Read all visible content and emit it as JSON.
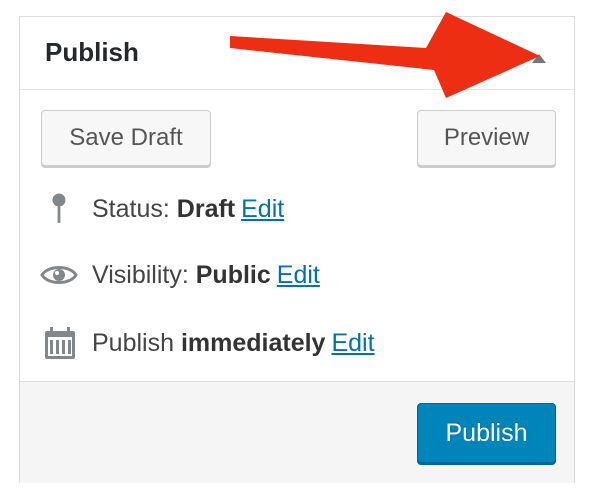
{
  "box": {
    "title": "Publish",
    "toggle_icon": "triangle-up-icon"
  },
  "actions": {
    "save_draft_label": "Save Draft",
    "preview_label": "Preview",
    "publish_label": "Publish"
  },
  "status": {
    "icon": "pin-icon",
    "label": "Status:",
    "value": "Draft",
    "edit_label": "Edit"
  },
  "visibility": {
    "icon": "eye-icon",
    "label": "Visibility:",
    "value": "Public",
    "edit_label": "Edit"
  },
  "schedule": {
    "icon": "calendar-icon",
    "label": "Publish",
    "value": "immediately",
    "edit_label": "Edit"
  },
  "annotation": {
    "type": "red-arrow",
    "color": "#ee2e12"
  },
  "colors": {
    "primary_button": "#0085ba",
    "link": "#0073aa"
  }
}
